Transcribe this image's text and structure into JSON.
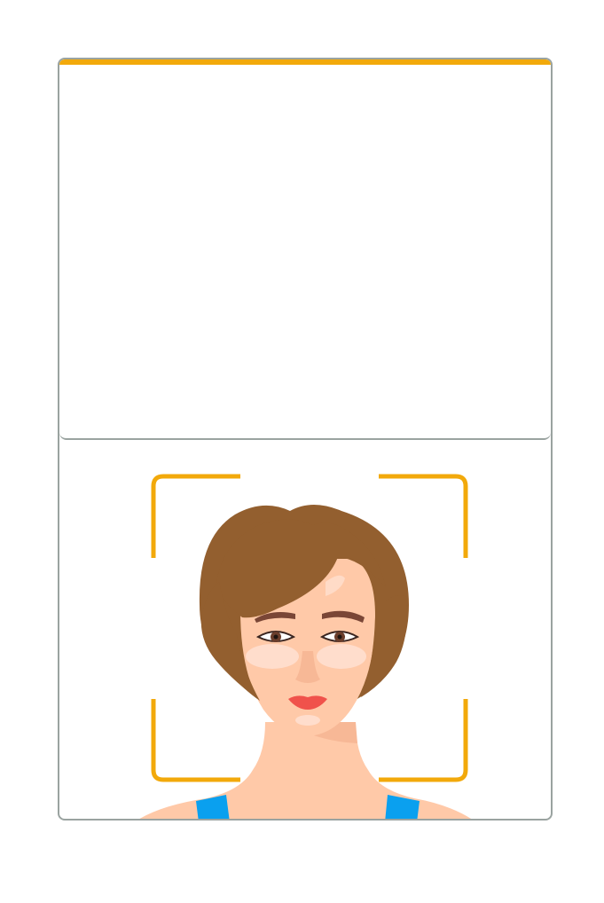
{
  "colors": {
    "accent": "#f2a90b",
    "border": "#9aa3a0",
    "hair": "#935f2f",
    "skin": "#ffc9a8",
    "skin_shadow": "#f7b896",
    "highlight": "#ffe2d4",
    "brow": "#7a4636",
    "lips": "#f0524b",
    "top_strap": "#0aa0ef"
  },
  "illustration": {
    "subject": "woman-portrait",
    "frame": "face-scan-corner-brackets"
  }
}
